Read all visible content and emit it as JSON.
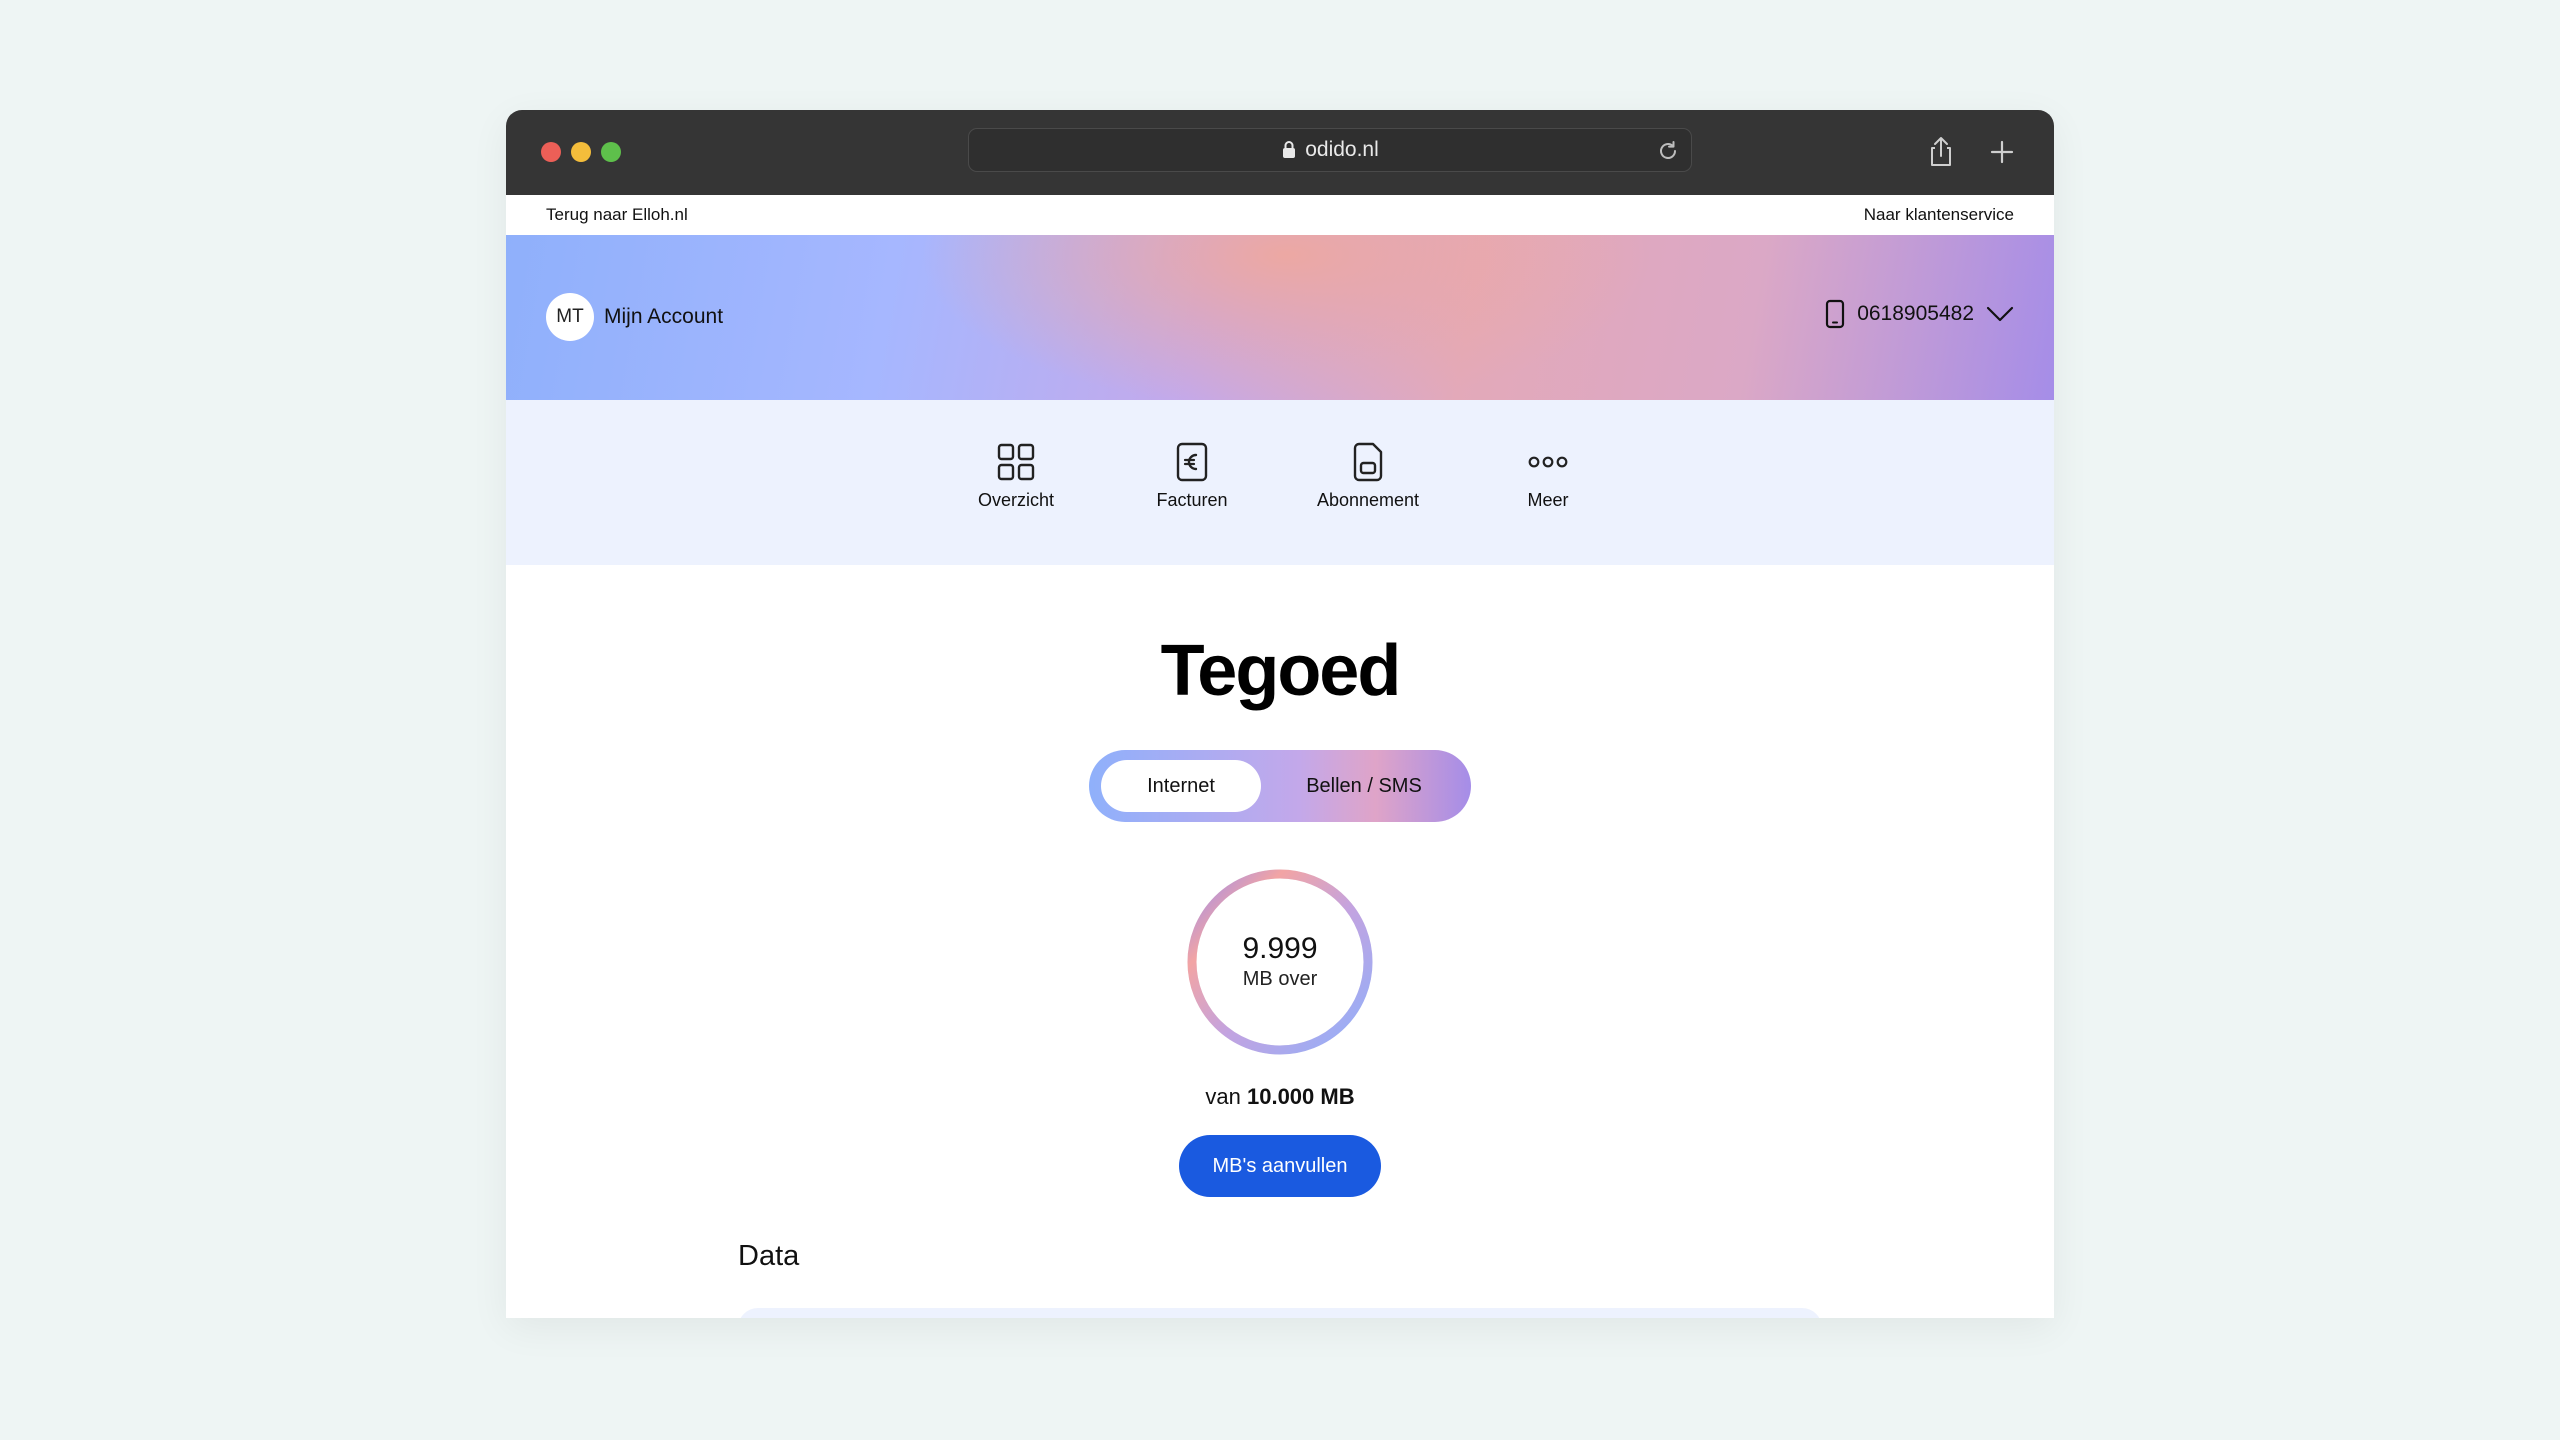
{
  "browser": {
    "url": "odido.nl",
    "icons": [
      "back-icon",
      "forward-icon",
      "lock-icon",
      "reload-icon",
      "share-icon",
      "new-tab-icon"
    ]
  },
  "topbar": {
    "back_link": "Terug naar Elloh.nl",
    "service_link": "Naar klantenservice"
  },
  "header": {
    "avatar_initials": "MT",
    "account_label": "Mijn Account",
    "phone_number": "0618905482"
  },
  "nav": {
    "items": [
      {
        "label": "Overzicht",
        "icon": "grid-icon"
      },
      {
        "label": "Facturen",
        "icon": "euro-document-icon"
      },
      {
        "label": "Abonnement",
        "icon": "sim-card-icon"
      },
      {
        "label": "Meer",
        "icon": "more-dots-icon"
      }
    ]
  },
  "main": {
    "title": "Tegoed",
    "toggle": {
      "options": [
        "Internet",
        "Bellen / SMS"
      ],
      "selected": "Internet"
    },
    "gauge": {
      "value": "9.999",
      "unit_label": "MB over",
      "fraction_remaining": 0.9999
    },
    "total_prefix": "van",
    "total_value": "10.000 MB",
    "cta_label": "MB's aanvullen",
    "section_title": "Data"
  },
  "colors": {
    "cta": "#1a5ae0",
    "nav_background": "#edf2fe",
    "chrome": "#353535"
  }
}
